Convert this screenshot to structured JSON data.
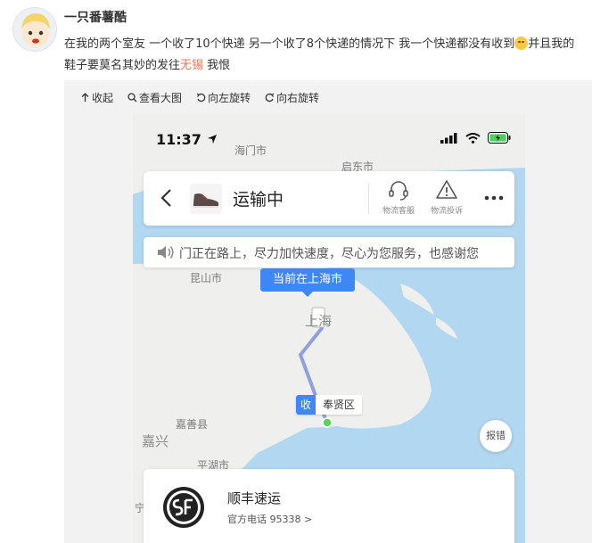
{
  "post": {
    "username": "一只番薯酷",
    "text_part1": "在我的两个室友 一个收了10个快递 另一个收了8个快递的情况下 我一个快递都没有收到",
    "text_part2": "并且我的鞋子要莫名其妙的发往",
    "highlight": "无锡",
    "text_part3": " 我恨",
    "emoji_icon": "sad-face-emoji-icon",
    "highlight_color": "#eb7350"
  },
  "toolbar": {
    "collapse": "收起",
    "view_large": "查看大图",
    "rotate_left": "向左旋转",
    "rotate_right": "向右旋转"
  },
  "phone": {
    "time": "11:37",
    "status_icons": [
      "location-arrow-icon",
      "signal-icon",
      "wifi-icon",
      "battery-charging-icon"
    ],
    "order_status": "运输中",
    "actions": [
      {
        "label": "物流客服",
        "icon": "headset-icon"
      },
      {
        "label": "物流投诉",
        "icon": "warning-icon"
      }
    ],
    "more_icon": "more-dots-icon",
    "notice_text": "门正在路上，尽力加快速度，尽心为您服务，也感谢您",
    "current_location": "当前在上海市",
    "receiver_tag": "收",
    "receiver_place": "奉贤区",
    "report_label": "报错",
    "courier_name": "顺丰速运",
    "courier_phone": "官方电话 95338 >"
  },
  "map_labels": {
    "haimen": "海门市",
    "qidong": "启东市",
    "kunshan": "昆山市",
    "shanghai": "上海",
    "jiashan": "嘉善县",
    "jiaxing": "嘉兴",
    "pinghu": "平湖市",
    "partial": "宁"
  },
  "colors": {
    "accent_blue": "#3f86f7",
    "sea": "#b2d7f0",
    "land": "#eff0ee",
    "route": "#8fa0e0",
    "battery": "#4bd05c"
  }
}
